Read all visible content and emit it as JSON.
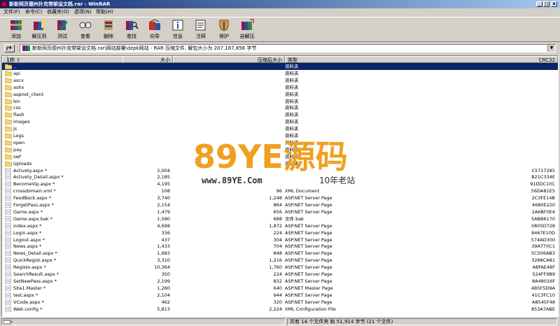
{
  "window": {
    "title": "新新网页德州扑克带架设文档.rar - WinRAR"
  },
  "menu": [
    {
      "label": "文件(F)"
    },
    {
      "label": "命令(C)"
    },
    {
      "label": "收藏夹(O)"
    },
    {
      "label": "选项(N)"
    },
    {
      "label": "帮助(H)"
    }
  ],
  "toolbar": [
    {
      "label": "添加",
      "icon": "add-icon"
    },
    {
      "label": "解压到",
      "icon": "extract-icon"
    },
    {
      "label": "测试",
      "icon": "test-icon"
    },
    {
      "label": "查看",
      "icon": "view-icon"
    },
    {
      "label": "删除",
      "icon": "delete-icon"
    },
    {
      "label": "查找",
      "icon": "find-icon"
    },
    {
      "label": "向导",
      "icon": "wizard-icon"
    },
    {
      "label": "信息",
      "icon": "info-icon"
    },
    {
      "label": "注释",
      "icon": "comment-icon"
    },
    {
      "label": "保护",
      "icon": "protect-icon"
    },
    {
      "label": "自解压",
      "icon": "sfx-icon"
    }
  ],
  "address": {
    "path": "新新网页德州扑克带架设文档.rar\\网站部署\\dzpk网站 - RAR 压缩文件, 解包大小为 207,187,856 字节"
  },
  "columns": {
    "name": "名称",
    "size": "大小",
    "packed": "压缩后大小",
    "type": "类型",
    "crc": "CRC32"
  },
  "files": [
    {
      "name": "..",
      "size": "",
      "packed": "",
      "type": "资料夹",
      "crc": "",
      "folder": true,
      "selected": true
    },
    {
      "name": "api",
      "size": "",
      "packed": "",
      "type": "资料夹",
      "crc": "",
      "folder": true
    },
    {
      "name": "ascx",
      "size": "",
      "packed": "",
      "type": "资料夹",
      "crc": "",
      "folder": true
    },
    {
      "name": "ashx",
      "size": "",
      "packed": "",
      "type": "资料夹",
      "crc": "",
      "folder": true
    },
    {
      "name": "aspnet_client",
      "size": "",
      "packed": "",
      "type": "资料夹",
      "crc": "",
      "folder": true
    },
    {
      "name": "bin",
      "size": "",
      "packed": "",
      "type": "资料夹",
      "crc": "",
      "folder": true
    },
    {
      "name": "css",
      "size": "",
      "packed": "",
      "type": "资料夹",
      "crc": "",
      "folder": true
    },
    {
      "name": "flash",
      "size": "",
      "packed": "",
      "type": "资料夹",
      "crc": "",
      "folder": true
    },
    {
      "name": "images",
      "size": "",
      "packed": "",
      "type": "资料夹",
      "crc": "",
      "folder": true
    },
    {
      "name": "js",
      "size": "",
      "packed": "",
      "type": "资料夹",
      "crc": "",
      "folder": true
    },
    {
      "name": "Logs",
      "size": "",
      "packed": "",
      "type": "资料夹",
      "crc": "",
      "folder": true
    },
    {
      "name": "open",
      "size": "",
      "packed": "",
      "type": "资料夹",
      "crc": "",
      "folder": true
    },
    {
      "name": "pay",
      "size": "",
      "packed": "",
      "type": "资料夹",
      "crc": "",
      "folder": true
    },
    {
      "name": "swf",
      "size": "",
      "packed": "",
      "type": "资料夹",
      "crc": "",
      "folder": true
    },
    {
      "name": "Uploadx",
      "size": "",
      "packed": "",
      "type": "资料夹",
      "crc": "",
      "folder": true
    },
    {
      "name": "Activety.aspx *",
      "size": "2,004",
      "packed": "",
      "type": "",
      "crc": "C5717285",
      "folder": false
    },
    {
      "name": "Activety_Detail.aspx *",
      "size": "2,185",
      "packed": "",
      "type": "",
      "crc": "B21C334E",
      "folder": false
    },
    {
      "name": "BecomeVip.aspx *",
      "size": "4,195",
      "packed": "",
      "type": "",
      "crc": "91DDC10C",
      "folder": false
    },
    {
      "name": "crossdomain.xml *",
      "size": "108",
      "packed": "96",
      "type": "XML Document",
      "crc": "56DA81E5",
      "folder": false
    },
    {
      "name": "FeedBack.aspx *",
      "size": "3,740",
      "packed": "1,248",
      "type": "ASP.NET Server Page",
      "crc": "2C3FE14B",
      "folder": false
    },
    {
      "name": "ForgetPass.aspx *",
      "size": "2,154",
      "packed": "864",
      "type": "ASP.NET Server Page",
      "crc": "4680E220",
      "folder": false
    },
    {
      "name": "Game.aspx *",
      "size": "1,479",
      "packed": "656",
      "type": "ASP.NET Server Page",
      "crc": "2A6BF0E4",
      "folder": false
    },
    {
      "name": "Game.aspx.bak *",
      "size": "1,580",
      "packed": "688",
      "type": "文件 bak",
      "crc": "5ABB6170",
      "folder": false
    },
    {
      "name": "index.aspx *",
      "size": "4,698",
      "packed": "1,872",
      "type": "ASP.NET Server Page",
      "crc": "0805D728",
      "folder": false
    },
    {
      "name": "Login.aspx *",
      "size": "336",
      "packed": "224",
      "type": "ASP.NET Server Page",
      "crc": "8467E10D",
      "folder": false
    },
    {
      "name": "Logout.aspx *",
      "size": "437",
      "packed": "304",
      "type": "ASP.NET Server Page",
      "crc": "574AD300",
      "folder": false
    },
    {
      "name": "News.aspx *",
      "size": "1,433",
      "packed": "704",
      "type": "ASP.NET Server Page",
      "crc": "39A770C1",
      "folder": false
    },
    {
      "name": "News_Detail.aspx *",
      "size": "1,683",
      "packed": "848",
      "type": "ASP.NET Server Page",
      "crc": "5C506AB3",
      "folder": false
    },
    {
      "name": "QuickRegist.aspx *",
      "size": "3,310",
      "packed": "1,216",
      "type": "ASP.NET Server Page",
      "crc": "3288CA81",
      "folder": false
    },
    {
      "name": "Registe.aspx *",
      "size": "10,364",
      "packed": "1,760",
      "type": "ASP.NET Server Page",
      "crc": "A8FAE48F",
      "folder": false
    },
    {
      "name": "SearchResult.aspx *",
      "size": "350",
      "packed": "224",
      "type": "ASP.NET Server Page",
      "crc": "524FF9B9",
      "folder": false
    },
    {
      "name": "SetNewPass.aspx *",
      "size": "2,199",
      "packed": "832",
      "type": "ASP.NET Server Page",
      "crc": "8A48016F",
      "folder": false
    },
    {
      "name": "Site1.Master *",
      "size": "1,280",
      "packed": "640",
      "type": "ASP.NET Master Page",
      "crc": "4B5F5D9A",
      "folder": false
    },
    {
      "name": "test.aspx *",
      "size": "2,104",
      "packed": "944",
      "type": "ASP.NET Server Page",
      "crc": "41C3FC10",
      "folder": false
    },
    {
      "name": "VCode.aspx *",
      "size": "462",
      "packed": "320",
      "type": "ASP.NET Server Page",
      "crc": "A8545F48",
      "folder": false
    },
    {
      "name": "Web.config *",
      "size": "5,813",
      "packed": "2,224",
      "type": "XML Configuration File",
      "crc": "853A7ABE",
      "folder": false
    }
  ],
  "status": {
    "text": "共有 14 个文件夹 和 51,914 字节 (21 个文件)"
  },
  "watermark": {
    "logo_text": "89YE源码",
    "url": "www.89YE.Com",
    "slogan": "10年老站"
  },
  "colors": {
    "selection": "#0a246a",
    "folder": "#f2d472",
    "title_from": "#0a246a",
    "title_to": "#a6caf0"
  }
}
